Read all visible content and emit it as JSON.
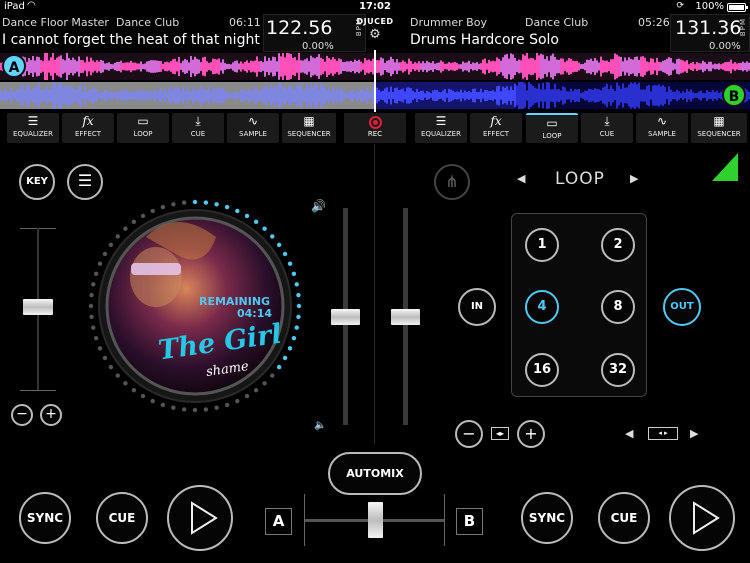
{
  "status": {
    "carrier": "iPad",
    "time": "17:02",
    "battery": "100%"
  },
  "deck_a": {
    "artist": "Dance Floor Master",
    "genre": "Dance Club",
    "time": "06:11",
    "title": "I cannot forget the heat of that night",
    "bpm": "122.56",
    "bpm_label": "BPM",
    "pitch": "0.00%",
    "badge": "A",
    "tools": [
      "EQUALIZER",
      "EFFECT",
      "LOOP",
      "CUE",
      "SAMPLE",
      "SEQUENCER"
    ],
    "key_label": "KEY",
    "sync_label": "SYNC",
    "cue_label": "CUE",
    "remaining_label": "REMAINING",
    "remaining_time": "04:14",
    "album_title": "The Girl",
    "album_artist": "shame"
  },
  "deck_b": {
    "artist": "Drummer Boy",
    "genre": "Dance Club",
    "time": "05:26",
    "title": "Drums Hardcore Solo",
    "bpm": "131.36",
    "bpm_label": "BPM",
    "pitch": "0.00%",
    "badge": "B",
    "tools": [
      "EQUALIZER",
      "EFFECT",
      "LOOP",
      "CUE",
      "SAMPLE",
      "SEQUENCER"
    ],
    "active_tool": "LOOP",
    "sync_label": "SYNC",
    "cue_label": "CUE"
  },
  "center": {
    "logo": "DJUCED",
    "rec_label": "REC",
    "automix_label": "AUTOMIX",
    "cross_a": "A",
    "cross_b": "B"
  },
  "loop_panel": {
    "title": "LOOP",
    "in_label": "IN",
    "out_label": "OUT",
    "pads": [
      "1",
      "2",
      "4",
      "8",
      "16",
      "32"
    ],
    "selected_pad": "4"
  },
  "colors": {
    "accent": "#4fc9f7",
    "deck_a": "#5fd6ff",
    "deck_b": "#2fd12f",
    "rec": "#e0203a"
  }
}
